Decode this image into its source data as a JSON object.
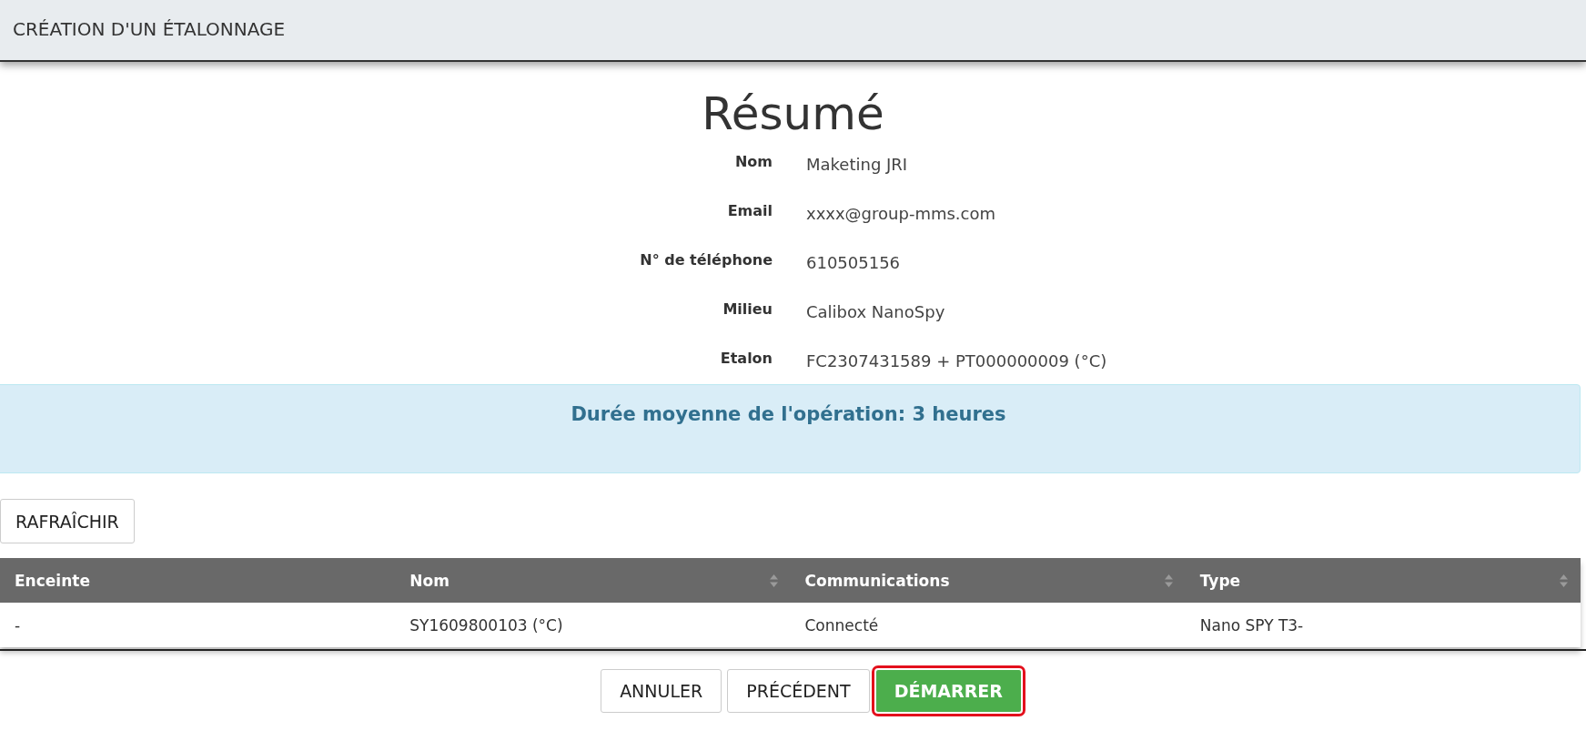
{
  "dialog": {
    "title": "CRÉATION D'UN ÉTALONNAGE"
  },
  "summary": {
    "heading": "Résumé",
    "fields": [
      {
        "label": "Nom",
        "value": "Maketing JRI"
      },
      {
        "label": "Email",
        "value": "xxxx@group-mms.com"
      },
      {
        "label": "N° de téléphone",
        "value": "610505156"
      },
      {
        "label": "Milieu",
        "value": "Calibox NanoSpy"
      },
      {
        "label": "Etalon",
        "value": "FC2307431589 + PT000000009 (°C)"
      }
    ]
  },
  "alert": "Durée moyenne de l'opération: 3 heures",
  "refresh_button": "RAFRAÎCHIR",
  "table": {
    "columns": [
      {
        "label": "Enceinte",
        "sortable": false
      },
      {
        "label": "Nom",
        "sortable": true
      },
      {
        "label": "Communications",
        "sortable": true
      },
      {
        "label": "Type",
        "sortable": true
      }
    ],
    "rows": [
      [
        "-",
        "SY1609800103 (°C)",
        "Connecté",
        "Nano SPY T3-"
      ]
    ]
  },
  "buttons": [
    {
      "label": "ANNULER",
      "kind": "default"
    },
    {
      "label": "PRÉCÉDENT",
      "kind": "default"
    },
    {
      "label": "DÉMARRER",
      "kind": "primary"
    }
  ]
}
